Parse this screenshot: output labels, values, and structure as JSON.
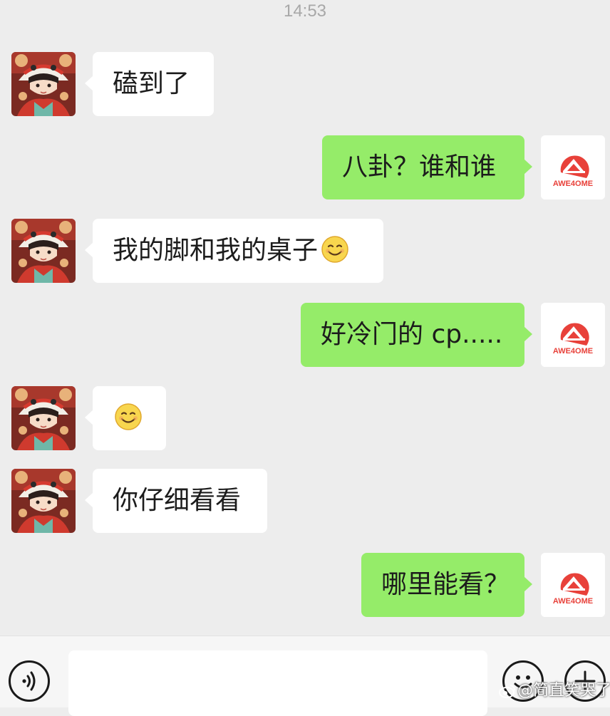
{
  "status": {
    "time": "14:53"
  },
  "contact": {
    "avatar_icon": "anime-girl-lion-dance-hat-avatar"
  },
  "me": {
    "avatar_icon": "awesome-logo-avatar",
    "avatar_text": "AWE4OME",
    "brand_color": "#e8413a"
  },
  "messages": [
    {
      "side": "in",
      "text": "磕到了"
    },
    {
      "side": "out",
      "text": "八卦？谁和谁"
    },
    {
      "side": "in",
      "text": "我的脚和我的桌子",
      "emoji": "smiley-emoji"
    },
    {
      "side": "out",
      "text": "好冷门的 cp....."
    },
    {
      "side": "in",
      "text": "",
      "emoji": "smiley-emoji"
    },
    {
      "side": "in",
      "text": "你仔细看看"
    },
    {
      "side": "out",
      "text": "哪里能看？"
    }
  ],
  "input_bar": {
    "voice_icon": "voice-wave-icon",
    "emoji_icon": "emoji-smile-icon",
    "plus_icon": "plus-icon",
    "input_value": ""
  },
  "watermark": {
    "text": "@简直笑哭了",
    "icon": "weibo-logo-icon"
  },
  "colors": {
    "background": "#ededed",
    "incoming": "#ffffff",
    "outgoing": "#95ec69"
  }
}
